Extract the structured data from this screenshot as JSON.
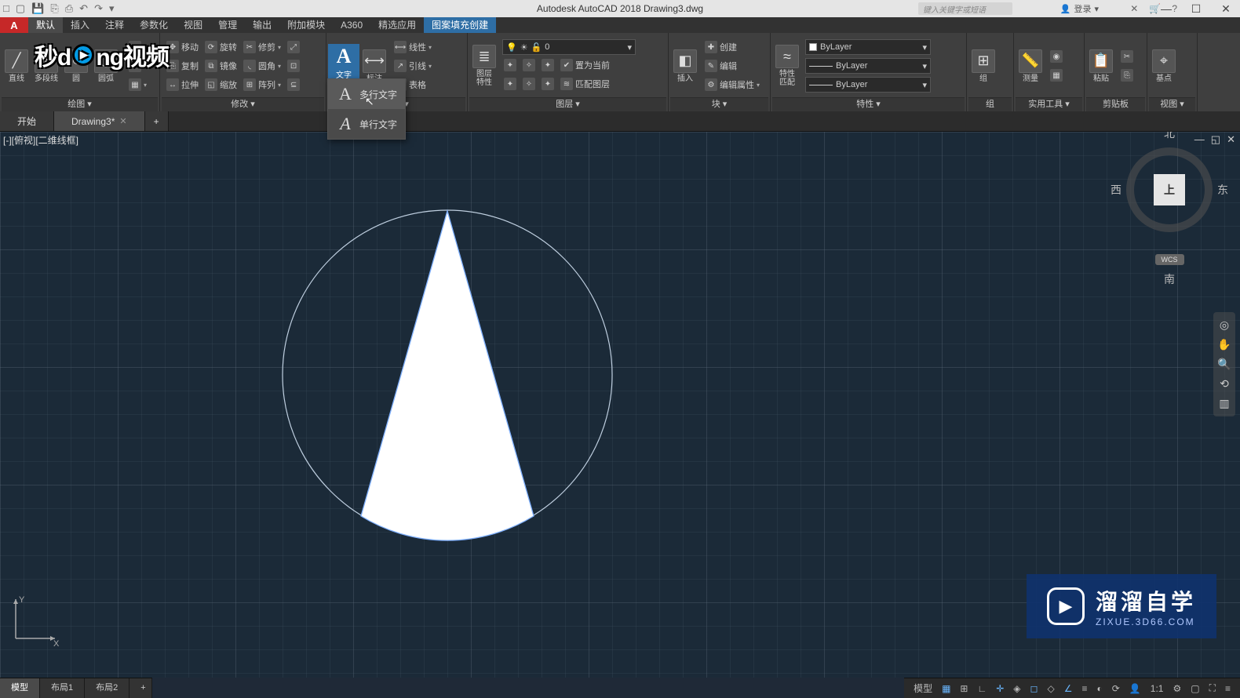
{
  "title": "Autodesk AutoCAD 2018   Drawing3.dwg",
  "search_placeholder": "键入关键字或短语",
  "signin_label": "登录",
  "win": {
    "min": "—",
    "max": "☐",
    "close": "✕"
  },
  "menus": [
    "默认",
    "插入",
    "注释",
    "参数化",
    "视图",
    "管理",
    "输出",
    "附加模块",
    "A360",
    "精选应用",
    "图案填充创建"
  ],
  "active_menu": 0,
  "highlighted_menu": 10,
  "panels": {
    "draw": {
      "label": "绘图 ▾",
      "big": [
        "直线",
        "多段线",
        "圆",
        "圆弧"
      ]
    },
    "modify": {
      "label": "修改 ▾",
      "rows": [
        [
          {
            "l": "移动"
          },
          {
            "l": "旋转"
          },
          {
            "l": "修剪",
            "a": true
          }
        ],
        [
          {
            "l": "复制"
          },
          {
            "l": "镜像"
          },
          {
            "l": "圆角",
            "a": true
          }
        ],
        [
          {
            "l": "拉伸"
          },
          {
            "l": "缩放"
          },
          {
            "l": "阵列",
            "a": true
          }
        ]
      ]
    },
    "annot": {
      "label": "注释 ▾",
      "text": "文字",
      "dim": "标注",
      "rows": [
        {
          "l": "线性",
          "a": true
        },
        {
          "l": "引线",
          "a": true
        },
        {
          "l": "表格"
        }
      ]
    },
    "layer": {
      "label": "图层 ▾",
      "big": "图层\n特性",
      "combo": "0",
      "btn1": "置为当前",
      "btn2": "匹配图层"
    },
    "block": {
      "label": "块 ▾",
      "big": "插入",
      "r": [
        "创建",
        "编辑",
        "编辑属性"
      ]
    },
    "prop": {
      "label": "特性 ▾",
      "big": "特性\n匹配",
      "combos": [
        "ByLayer",
        "ByLayer",
        "ByLayer"
      ]
    },
    "group": {
      "label": "组",
      "big": "组"
    },
    "util": {
      "label": "实用工具 ▾",
      "big": "测量"
    },
    "clip": {
      "label": "剪贴板",
      "big": "粘贴"
    },
    "view": {
      "label": "视图 ▾",
      "big": "基点"
    }
  },
  "text_dropdown": [
    {
      "l": "多行文字"
    },
    {
      "l": "单行文字"
    }
  ],
  "watermark1_text": "秒d  ng视频",
  "file_tabs": [
    {
      "l": "开始",
      "active": false
    },
    {
      "l": "Drawing3*",
      "active": true
    }
  ],
  "viewport_label": "[-][俯视][二维线框]",
  "viewcube": {
    "n": "北",
    "s": "南",
    "w": "西",
    "e": "东",
    "face": "上",
    "wcs": "WCS"
  },
  "ucs": {
    "x": "X",
    "y": "Y"
  },
  "layout_tabs": [
    "模型",
    "布局1",
    "布局2"
  ],
  "status_model": "模型",
  "status_scale": "1:1",
  "watermark2": {
    "t1": "溜溜自学",
    "t2": "ZIXUE.3D66.COM"
  }
}
